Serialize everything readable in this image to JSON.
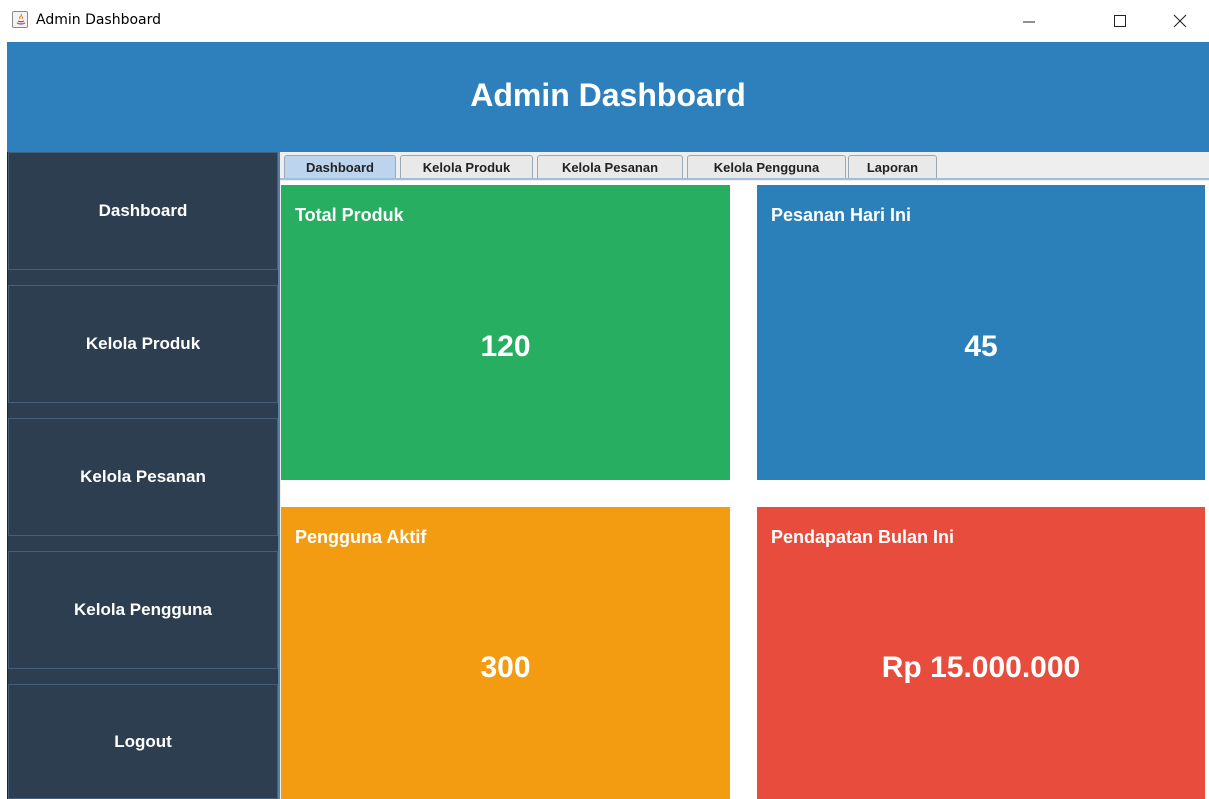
{
  "window": {
    "title": "Admin Dashboard",
    "icon": "java-icon"
  },
  "header": {
    "title": "Admin Dashboard"
  },
  "sidebar": {
    "items": [
      {
        "label": "Dashboard"
      },
      {
        "label": "Kelola Produk"
      },
      {
        "label": "Kelola Pesanan"
      },
      {
        "label": "Kelola Pengguna"
      },
      {
        "label": "Logout"
      }
    ]
  },
  "tabs": [
    {
      "label": "Dashboard",
      "active": true
    },
    {
      "label": "Kelola Produk",
      "active": false
    },
    {
      "label": "Kelola Pesanan",
      "active": false
    },
    {
      "label": "Kelola Pengguna",
      "active": false
    },
    {
      "label": "Laporan",
      "active": false
    }
  ],
  "cards": [
    {
      "title": "Total Produk",
      "value": "120",
      "color": "#27ae60"
    },
    {
      "title": "Pesanan Hari Ini",
      "value": "45",
      "color": "#2b80ba"
    },
    {
      "title": "Pengguna Aktif",
      "value": "300",
      "color": "#f39c12"
    },
    {
      "title": "Pendapatan Bulan Ini",
      "value": "Rp 15.000.000",
      "color": "#e74c3c"
    }
  ],
  "colors": {
    "header": "#2d80bb",
    "sidebar": "#2d3e50",
    "active_tab": "#bcd4ee"
  }
}
